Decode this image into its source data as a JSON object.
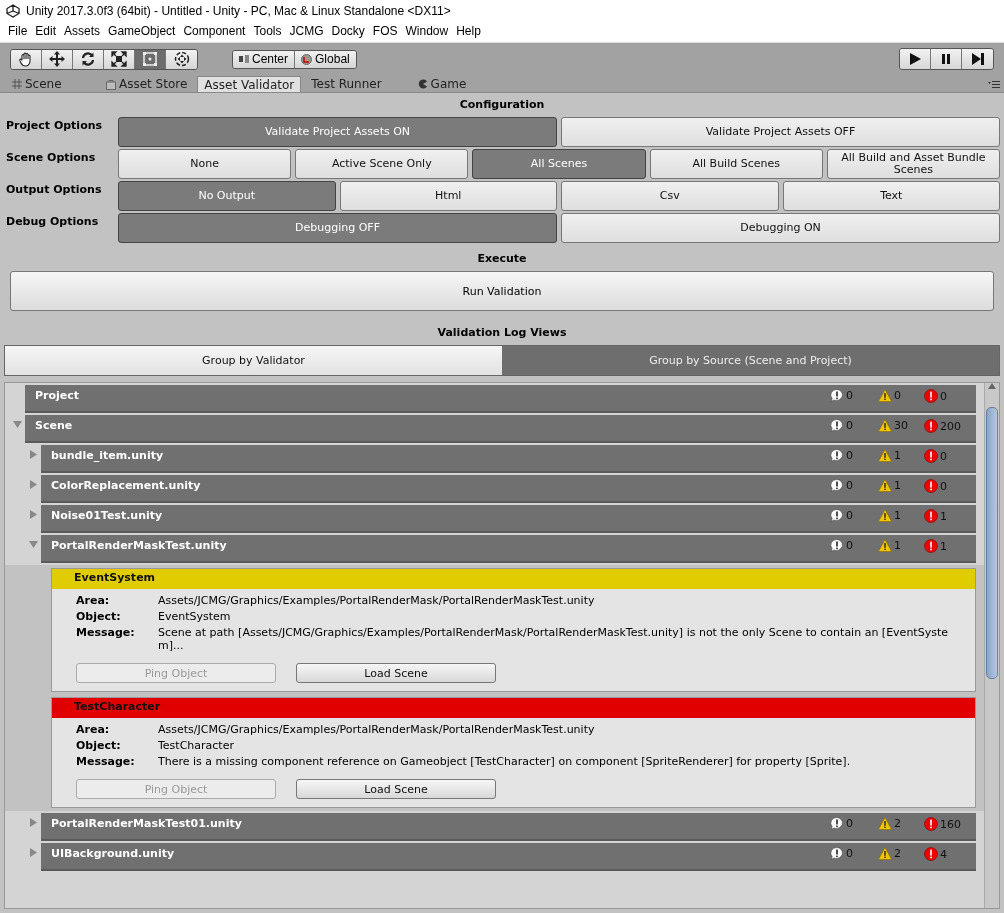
{
  "window": {
    "title": "Unity 2017.3.0f3 (64bit) - Untitled - Unity - PC, Mac & Linux Standalone <DX11>"
  },
  "menu": [
    "File",
    "Edit",
    "Assets",
    "GameObject",
    "Component",
    "Tools",
    "JCMG",
    "Docky",
    "FOS",
    "Window",
    "Help"
  ],
  "tools": [
    {
      "kind": "hand",
      "selected": false
    },
    {
      "kind": "move",
      "selected": false
    },
    {
      "kind": "rotate",
      "selected": false
    },
    {
      "kind": "scale",
      "selected": false
    },
    {
      "kind": "rect",
      "selected": true
    },
    {
      "kind": "transform",
      "selected": false
    }
  ],
  "pivot_buttons": [
    {
      "kind": "pivot",
      "label": "Center"
    },
    {
      "kind": "global",
      "label": "Global"
    }
  ],
  "playback": [
    {
      "kind": "play"
    },
    {
      "kind": "pause"
    },
    {
      "kind": "step"
    }
  ],
  "tabs": [
    {
      "kind": "scene",
      "label": "Scene",
      "selected": false
    },
    {
      "kind": "store",
      "label": "Asset Store",
      "selected": false
    },
    {
      "kind": "none",
      "label": "Asset Validator",
      "selected": true
    },
    {
      "kind": "none",
      "label": "Test Runner",
      "selected": false
    },
    {
      "kind": "game",
      "label": "Game",
      "selected": false
    }
  ],
  "configuration": {
    "title": "Configuration",
    "rows": [
      {
        "label": "Project Options",
        "options": [
          {
            "label": "Validate Project Assets ON",
            "selected": true
          },
          {
            "label": "Validate Project Assets OFF",
            "selected": false
          }
        ]
      },
      {
        "label": "Scene Options",
        "options": [
          {
            "label": "None",
            "selected": false
          },
          {
            "label": "Active Scene Only",
            "selected": false
          },
          {
            "label": "All Scenes",
            "selected": true
          },
          {
            "label": "All Build Scenes",
            "selected": false
          },
          {
            "label": "All Build and Asset Bundle Scenes",
            "selected": false
          }
        ]
      },
      {
        "label": "Output Options",
        "options": [
          {
            "label": "No Output",
            "selected": true
          },
          {
            "label": "Html",
            "selected": false
          },
          {
            "label": "Csv",
            "selected": false
          },
          {
            "label": "Text",
            "selected": false
          }
        ]
      },
      {
        "label": "Debug Options",
        "options": [
          {
            "label": "Debugging OFF",
            "selected": true
          },
          {
            "label": "Debugging ON",
            "selected": false
          }
        ]
      }
    ]
  },
  "execute": {
    "title": "Execute",
    "button": "Run Validation"
  },
  "log_views": {
    "title": "Validation Log Views",
    "tabs": [
      {
        "label": "Group by Validator",
        "selected": false
      },
      {
        "label": "Group by Source (Scene and Project)",
        "selected": true
      }
    ]
  },
  "log_tree": [
    {
      "name": "Project",
      "info": "0",
      "warning": "0",
      "error": "0"
    },
    {
      "name": "Scene",
      "expanded": true,
      "info": "0",
      "warning": "30",
      "error": "200",
      "children": [
        {
          "name": "bundle_item.unity",
          "expanded": false,
          "info": "0",
          "warning": "1",
          "error": "0"
        },
        {
          "name": "ColorReplacement.unity",
          "expanded": false,
          "info": "0",
          "warning": "1",
          "error": "0"
        },
        {
          "name": "Noise01Test.unity",
          "expanded": false,
          "info": "0",
          "warning": "1",
          "error": "1"
        },
        {
          "name": "PortalRenderMaskTest.unity",
          "expanded": true,
          "info": "0",
          "warning": "1",
          "error": "1",
          "entries": [
            {
              "title": "EventSystem",
              "color": "#e0cc00",
              "fields": [
                {
                  "label": "Area:",
                  "value": "Assets/JCMG/Graphics/Examples/PortalRenderMask/PortalRenderMaskTest.unity"
                },
                {
                  "label": "Object:",
                  "value": "EventSystem"
                },
                {
                  "label": "Message:",
                  "value": "Scene at path [Assets/JCMG/Graphics/Examples/PortalRenderMask/PortalRenderMaskTest.unity] is not the only Scene to contain an [EventSystem]..."
                }
              ],
              "buttons": [
                {
                  "label": "Ping Object",
                  "disabled": true
                },
                {
                  "label": "Load Scene",
                  "disabled": false
                }
              ]
            },
            {
              "title": "TestCharacter",
              "color": "#e00000",
              "fields": [
                {
                  "label": "Area:",
                  "value": "Assets/JCMG/Graphics/Examples/PortalRenderMask/PortalRenderMaskTest.unity"
                },
                {
                  "label": "Object:",
                  "value": "TestCharacter"
                },
                {
                  "label": "Message:",
                  "value": "There is a missing component reference on Gameobject [TestCharacter] on component [SpriteRenderer] for property [Sprite]."
                }
              ],
              "buttons": [
                {
                  "label": "Ping Object",
                  "disabled": true
                },
                {
                  "label": "Load Scene",
                  "disabled": false
                }
              ]
            }
          ]
        },
        {
          "name": "PortalRenderMaskTest01.unity",
          "expanded": false,
          "info": "0",
          "warning": "2",
          "error": "160"
        },
        {
          "name": "UIBackground.unity",
          "expanded": false,
          "info": "0",
          "warning": "2",
          "error": "4"
        }
      ]
    }
  ]
}
